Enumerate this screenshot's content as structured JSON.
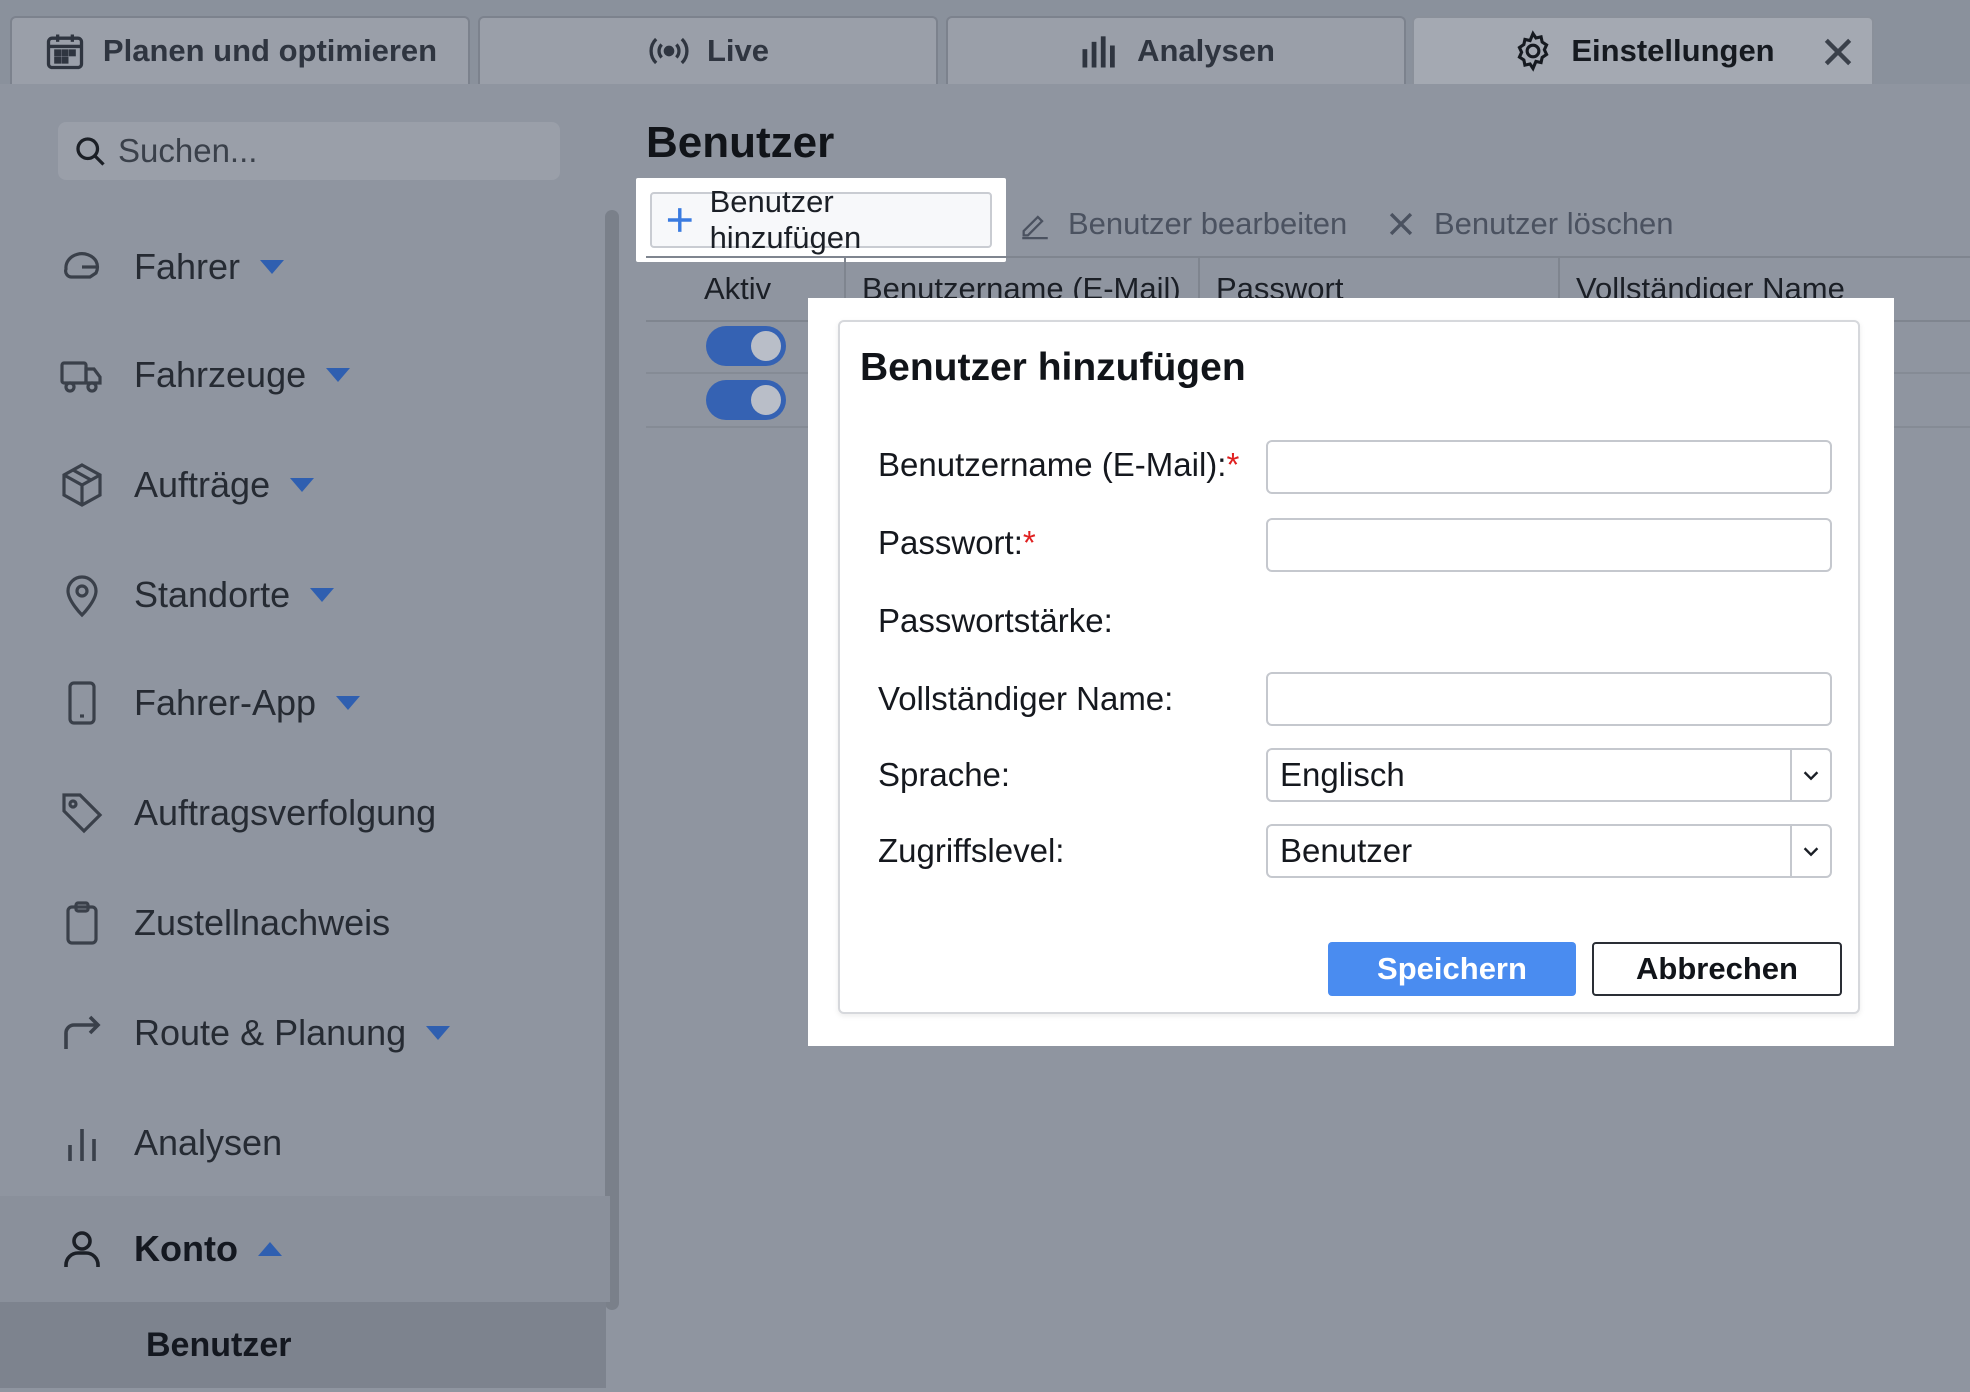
{
  "tabs": [
    {
      "label": "Planen und optimieren",
      "icon": "calendar-icon"
    },
    {
      "label": "Live",
      "icon": "broadcast-icon"
    },
    {
      "label": "Analysen",
      "icon": "bar-chart-icon"
    },
    {
      "label": "Einstellungen",
      "icon": "gear-icon",
      "active": true
    }
  ],
  "sidebar": {
    "search_placeholder": "Suchen...",
    "items": [
      {
        "label": "Fahrer",
        "icon": "driver-helmet-icon",
        "caret": "down"
      },
      {
        "label": "Fahrzeuge",
        "icon": "truck-icon",
        "caret": "down"
      },
      {
        "label": "Aufträge",
        "icon": "package-icon",
        "caret": "down"
      },
      {
        "label": "Standorte",
        "icon": "location-pin-icon",
        "caret": "down"
      },
      {
        "label": "Fahrer-App",
        "icon": "smartphone-icon",
        "caret": "down"
      },
      {
        "label": "Auftragsverfolgung",
        "icon": "tag-icon"
      },
      {
        "label": "Zustellnachweis",
        "icon": "clipboard-icon"
      },
      {
        "label": "Route & Planung",
        "icon": "route-arrow-icon",
        "caret": "down"
      },
      {
        "label": "Analysen",
        "icon": "bar-chart-icon"
      },
      {
        "label": "Konto",
        "icon": "user-icon",
        "caret": "up"
      }
    ],
    "sub_item": "Benutzer"
  },
  "main": {
    "title": "Benutzer",
    "toolbar": {
      "add": "Benutzer hinzufügen",
      "edit": "Benutzer bearbeiten",
      "delete": "Benutzer löschen"
    },
    "columns": [
      "Aktiv",
      "Benutzername (E-Mail)",
      "Passwort",
      "Vollständiger Name"
    ],
    "rows": [
      {
        "active": true
      },
      {
        "active": true
      }
    ]
  },
  "modal": {
    "title": "Benutzer hinzufügen",
    "fields": {
      "username_label": "Benutzername (E-Mail):",
      "password_label": "Passwort:",
      "strength_label": "Passwortstärke:",
      "fullname_label": "Vollständiger Name:",
      "language_label": "Sprache:",
      "language_value": "Englisch",
      "access_label": "Zugriffslevel:",
      "access_value": "Benutzer",
      "required_mark": "*"
    },
    "save": "Speichern",
    "cancel": "Abbrechen"
  },
  "colors": {
    "accent": "#4a8cf0",
    "toggle": "#3562b3",
    "required": "#e02020"
  }
}
